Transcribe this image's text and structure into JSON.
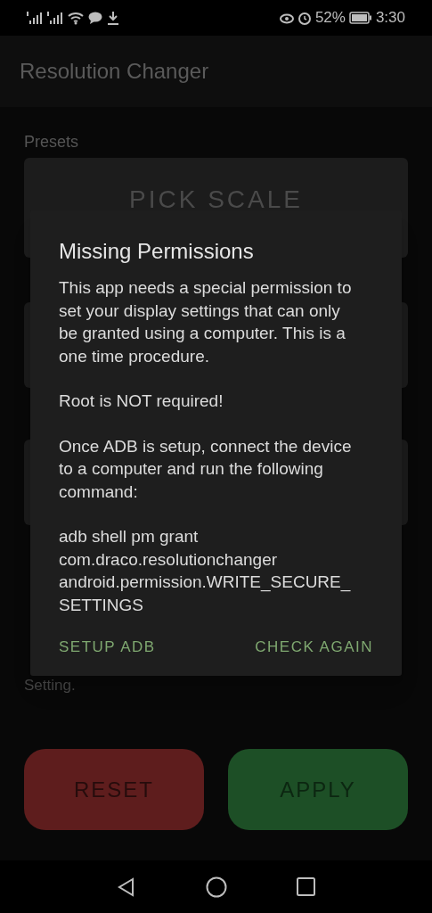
{
  "status_bar": {
    "battery": "52%",
    "time": "3:30"
  },
  "app_bar": {
    "title": "Resolution Changer"
  },
  "background": {
    "presets_label": "Presets",
    "pick_scale_button": "PICK SCALE",
    "note_fragments": [
      "Setting."
    ]
  },
  "dialog": {
    "title": "Missing Permissions",
    "paragraphs": [
      "This app needs a special permission to set your display settings that can only be granted using a computer. This is a one time procedure.",
      "Root is NOT required!",
      "Once ADB is setup, connect the device to a computer and run the following command:",
      "adb shell pm grant com.draco.resolutionchanger android.permission.WRITE_SECURE_SETTINGS"
    ],
    "buttons": [
      "SETUP ADB",
      "CHECK AGAIN"
    ]
  },
  "actions": [
    {
      "label": "RESET",
      "kind": "reset"
    },
    {
      "label": "APPLY",
      "kind": "apply"
    }
  ]
}
